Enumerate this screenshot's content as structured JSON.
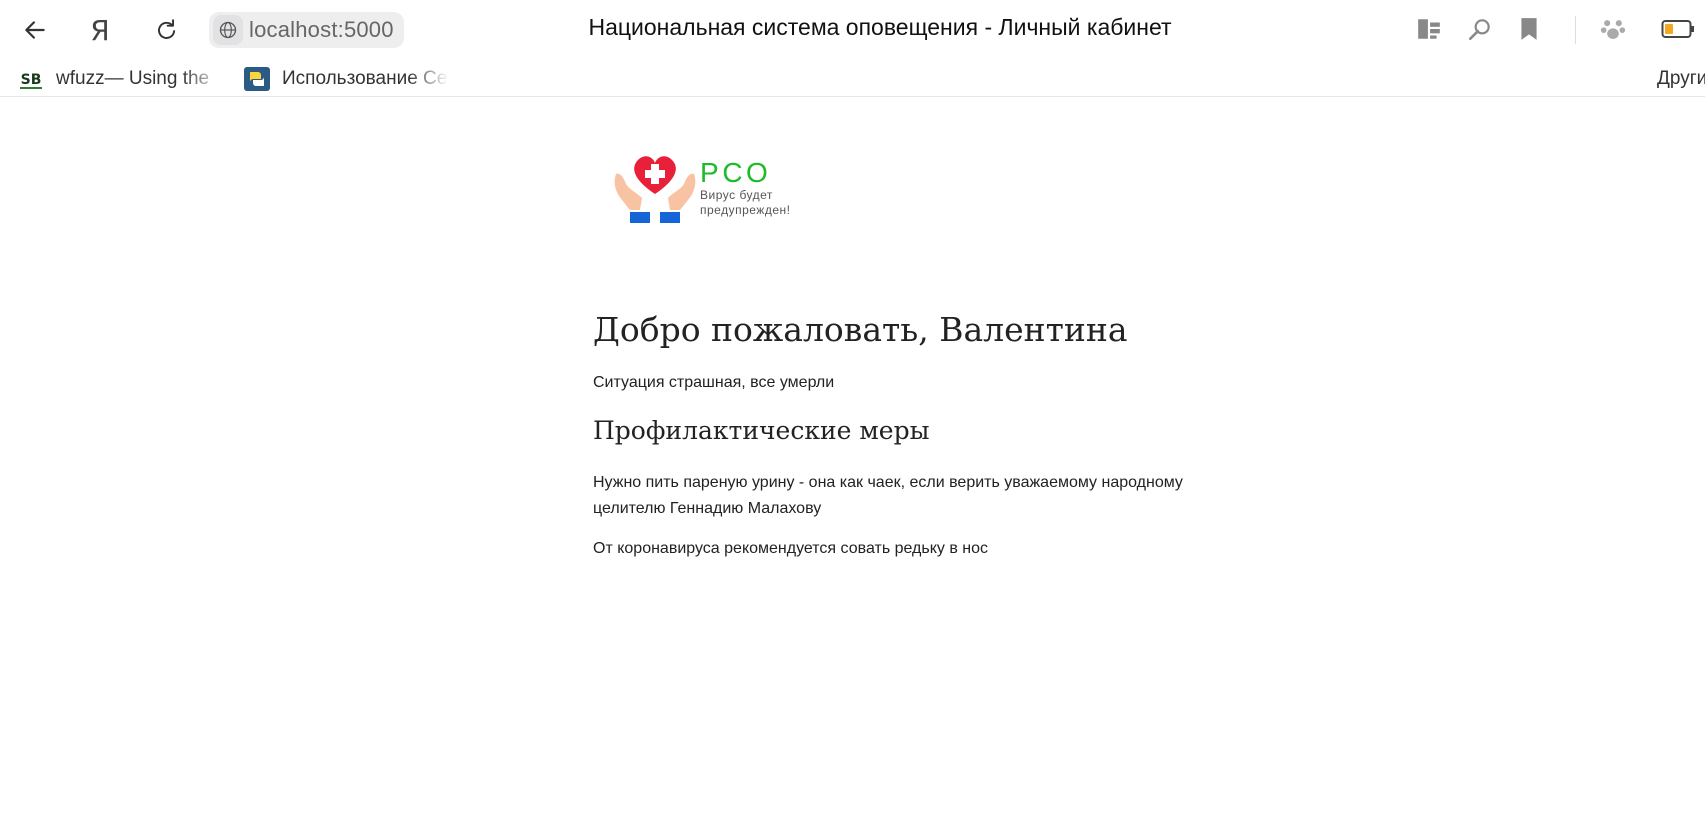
{
  "browser": {
    "url": "localhost:5000",
    "page_title": "Национальная система оповещения - Личный кабинет",
    "yandex_label": "Я",
    "bookmarks": [
      {
        "label": "wfuzz— Using the",
        "icon": "security-bytes-icon"
      },
      {
        "label": "Использование Ce",
        "icon": "python-icon"
      }
    ],
    "other_bookmarks": "Други"
  },
  "logo": {
    "name": "РСО",
    "tagline_line1": "Вирус будет",
    "tagline_line2": "предупрежден!",
    "heart_color": "#e8203a",
    "brand_color": "#1dbb2b"
  },
  "main": {
    "welcome": "Добро пожаловать, Валентина",
    "situation": "Ситуация страшная, все умерли",
    "measures_title": "Профилактические меры",
    "measures": [
      "Нужно пить пареную урину - она как чаек, если верить уважаемому народному целителю Геннадию Малахову",
      "От коронавируса рекомендуется совать редьку в нос"
    ]
  }
}
